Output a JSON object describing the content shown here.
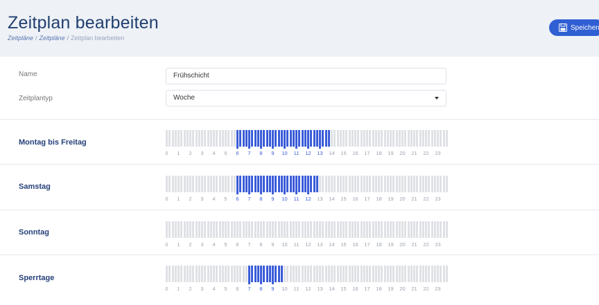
{
  "header": {
    "title": "Zeitplan bearbeiten",
    "breadcrumb": [
      "Zeitpläne",
      "Zeitpläne",
      "Zeitplan bearbeiten"
    ],
    "save_label": "Speichern",
    "save_icon": "floppy-disk-icon"
  },
  "form": {
    "name_label": "Name",
    "name_value": "Frühschicht",
    "type_label": "Zeitplantyp",
    "type_value": "Woche"
  },
  "colors": {
    "accent": "#3a5cd8",
    "inactive": "#dfe1e5",
    "button": "#2f5fd3",
    "label": "#26407a"
  },
  "schedule": {
    "hours": [
      "0",
      "1",
      "2",
      "3",
      "4",
      "5",
      "6",
      "7",
      "8",
      "9",
      "10",
      "11",
      "12",
      "13",
      "14",
      "15",
      "16",
      "17",
      "18",
      "19",
      "20",
      "21",
      "22",
      "23"
    ],
    "slots_per_hour": 4,
    "rows": [
      {
        "label": "Montag bis Freitag",
        "active": [
          [
            6.0,
            14.0
          ]
        ]
      },
      {
        "label": "Samstag",
        "active": [
          [
            6.0,
            13.0
          ]
        ]
      },
      {
        "label": "Sonntag",
        "active": []
      },
      {
        "label": "Sperrtage",
        "active": [
          [
            7.0,
            10.0
          ]
        ]
      }
    ]
  }
}
